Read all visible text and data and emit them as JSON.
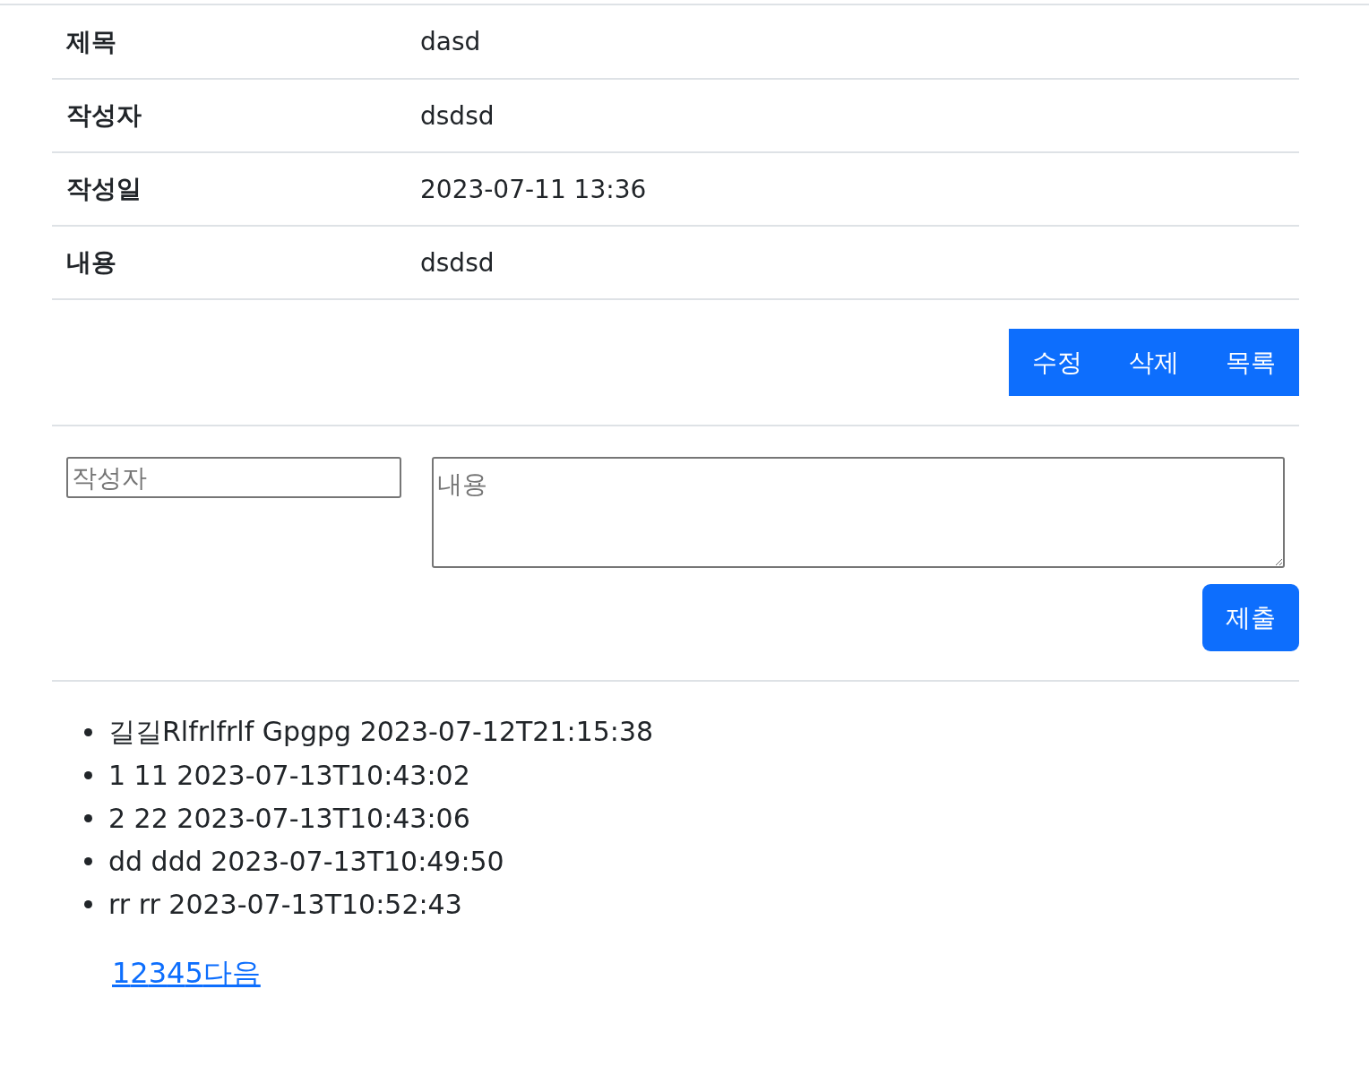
{
  "details": [
    {
      "label": "제목",
      "value": "dasd"
    },
    {
      "label": "작성자",
      "value": "dsdsd"
    },
    {
      "label": "작성일",
      "value": "2023-07-11 13:36"
    },
    {
      "label": "내용",
      "value": "dsdsd"
    }
  ],
  "actions": [
    "수정",
    "삭제",
    "목록"
  ],
  "comment_form": {
    "author": {
      "placeholder": "작성자"
    },
    "content": {
      "placeholder": "내용"
    },
    "submit": "제출"
  },
  "comments": [
    "길길Rlfrlfrlf Gpgpg 2023-07-12T21:15:38",
    "1 11 2023-07-13T10:43:02",
    "2 22 2023-07-13T10:43:06",
    "dd ddd 2023-07-13T10:49:50",
    "rr rr 2023-07-13T10:52:43"
  ],
  "pagination": [
    "1",
    "2",
    "3",
    "4",
    "5",
    "다음"
  ]
}
